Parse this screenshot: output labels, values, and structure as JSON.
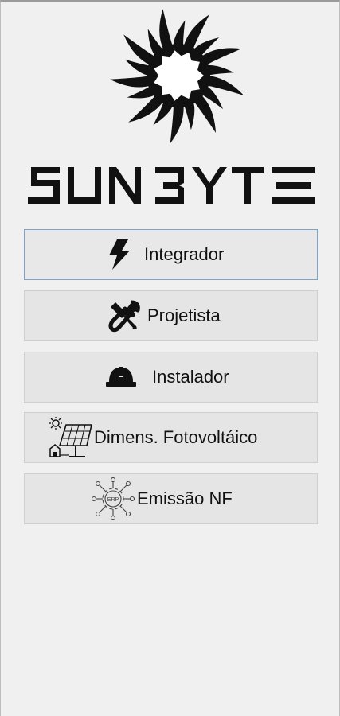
{
  "app": {
    "brand": "SUNBYTE"
  },
  "menu": {
    "items": [
      {
        "id": "integrador",
        "label": "Integrador",
        "icon": "lightning-bolt-icon",
        "active": true
      },
      {
        "id": "projetista",
        "label": "Projetista",
        "icon": "tools-icon",
        "active": false
      },
      {
        "id": "instalador",
        "label": "Instalador",
        "icon": "hard-hat-icon",
        "active": false
      },
      {
        "id": "dimens",
        "label": "Dimens. Fotovoltáico",
        "icon": "solar-panel-icon",
        "active": false
      },
      {
        "id": "nf",
        "label": "Emissão NF",
        "icon": "erp-network-icon",
        "active": false
      }
    ]
  },
  "colors": {
    "background": "#f0f0f0",
    "button": "#e5e5e5",
    "active_border": "#7da2ce",
    "text": "#111111"
  }
}
